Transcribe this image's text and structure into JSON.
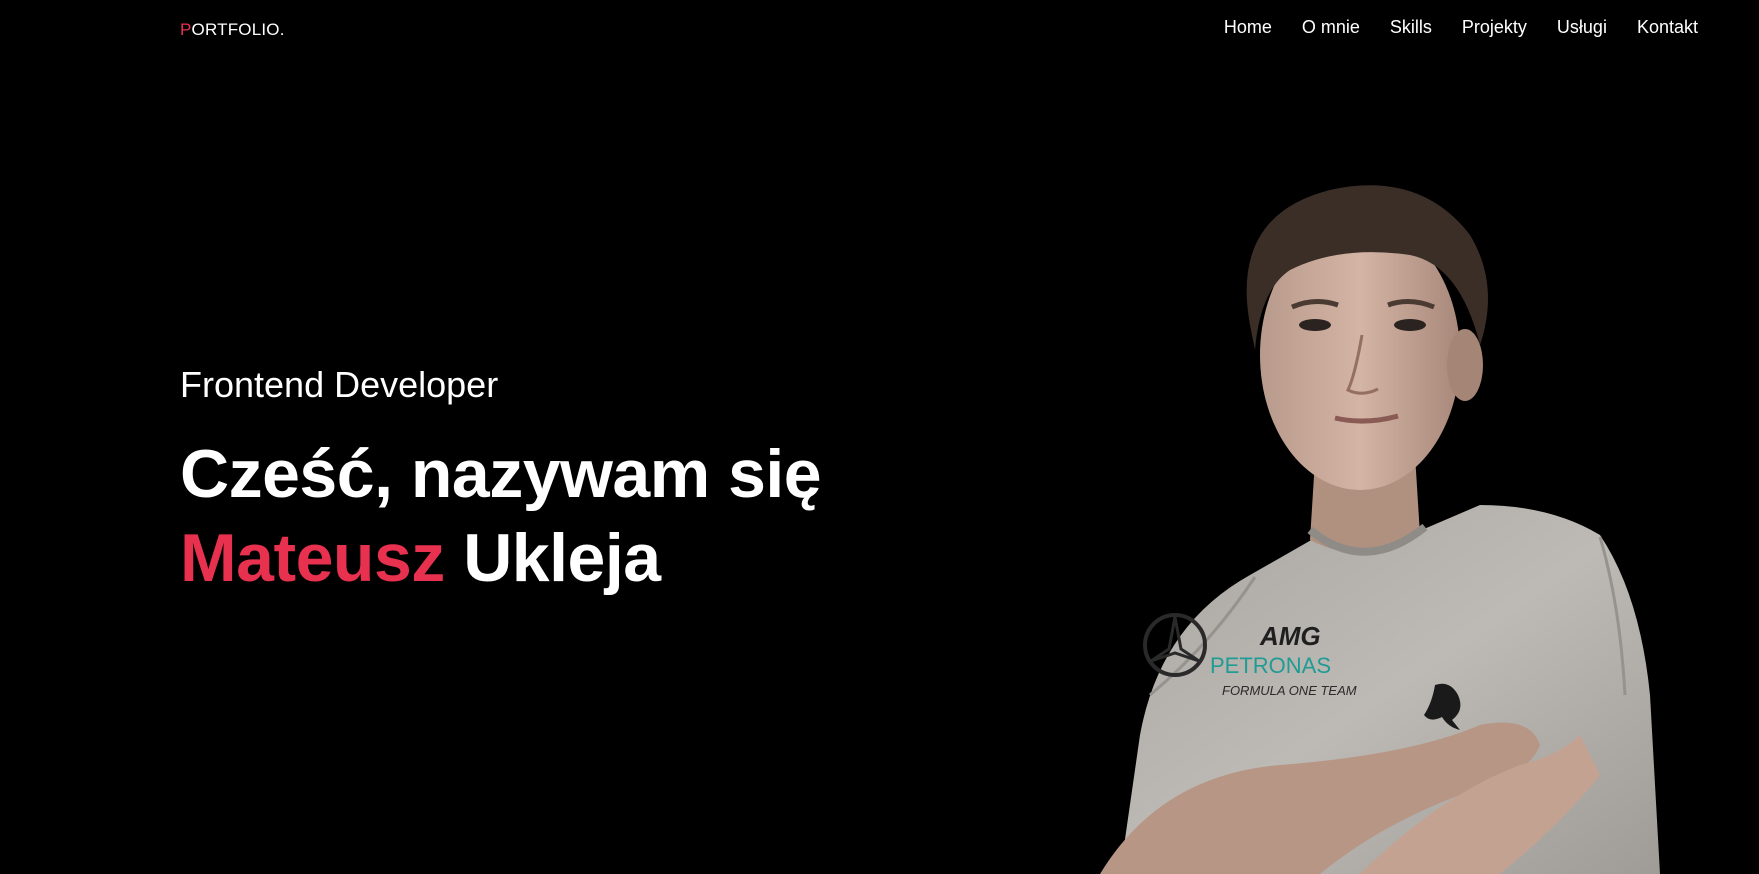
{
  "header": {
    "logo_first": "P",
    "logo_rest": "ORTFOLIO."
  },
  "nav": {
    "items": [
      "Home",
      "O mnie",
      "Skills",
      "Projekty",
      "Usługi",
      "Kontakt"
    ]
  },
  "hero": {
    "subtitle": "Frontend Developer",
    "greeting": "Cześć, nazywam się",
    "first_name": "Mateusz",
    "last_name": "Ukleja"
  },
  "shirt": {
    "brand_top": "AMG",
    "brand_mid": "PETRONAS",
    "brand_bottom": "FORMULA ONE TEAM"
  },
  "colors": {
    "background": "#000000",
    "accent": "#e8304f",
    "text": "#ffffff",
    "shirt": "#b9b6b1",
    "petronas": "#1f9c94"
  }
}
